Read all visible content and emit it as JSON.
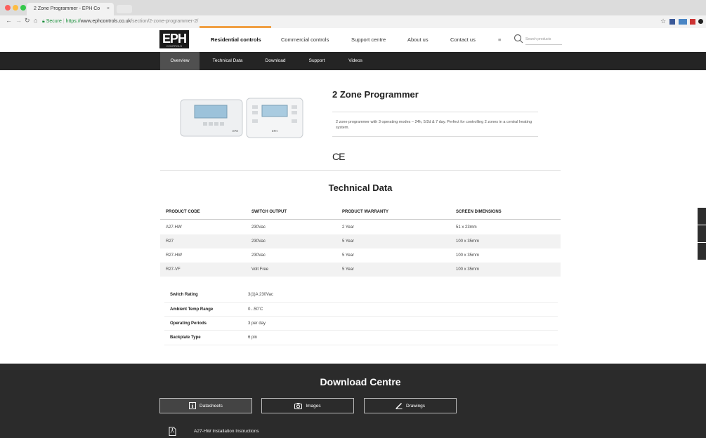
{
  "browser": {
    "tab_title": "2 Zone Programmer - EPH Co",
    "tab_close": "×",
    "secure_label": "Secure",
    "url_scheme": "https://",
    "url_host": "www.ephcontrols.co.uk",
    "url_path": "/section/2-zone-programmer-2/"
  },
  "header": {
    "logo_text": "EPH",
    "logo_tagline": "CONTROLS",
    "nav": [
      "Residential controls",
      "Commercial controls",
      "Support centre",
      "About us",
      "Contact us"
    ],
    "menu_glyph": "≡",
    "search_placeholder": "Search products"
  },
  "subnav": [
    "Overview",
    "Technical Data",
    "Download",
    "Support",
    "Videos"
  ],
  "product": {
    "title": "2 Zone Programmer",
    "description": "2 zone programmer with 3 operating modes – 24h, 5/2d & 7 day. Perfect for controlling 2 zones in a central heating system.",
    "ce_mark": "CE",
    "device_label": "EPH"
  },
  "technical": {
    "title": "Technical Data",
    "headers": [
      "PRODUCT CODE",
      "SWITCH OUTPUT",
      "PRODUCT WARRANTY",
      "SCREEN DIMENSIONS"
    ],
    "rows": [
      [
        "A27-HW",
        "230Vac",
        "2 Year",
        "51 x 23mm"
      ],
      [
        "R27",
        "230Vac",
        "5 Year",
        "100 x 35mm"
      ],
      [
        "R27-HW",
        "230Vac",
        "5 Year",
        "100 x 35mm"
      ],
      [
        "R27-VF",
        "Volt Free",
        "5 Year",
        "100 x 35mm"
      ]
    ],
    "specs": [
      {
        "label": "Switch Rating",
        "value": "3(1)A 230Vac"
      },
      {
        "label": "Ambient Temp Range",
        "value": "0...50˚C"
      },
      {
        "label": "Operating Periods",
        "value": "3 per day"
      },
      {
        "label": "Backplate Type",
        "value": "6 pin"
      }
    ]
  },
  "download": {
    "title": "Download Centre",
    "buttons": [
      "Datasheets",
      "Images",
      "Drawings"
    ],
    "links": [
      "A27-HW Installation Instructions"
    ]
  },
  "colors": {
    "accent": "#f0a044",
    "subnav_bg": "#242424",
    "footer_bg": "#2b2b2b"
  }
}
